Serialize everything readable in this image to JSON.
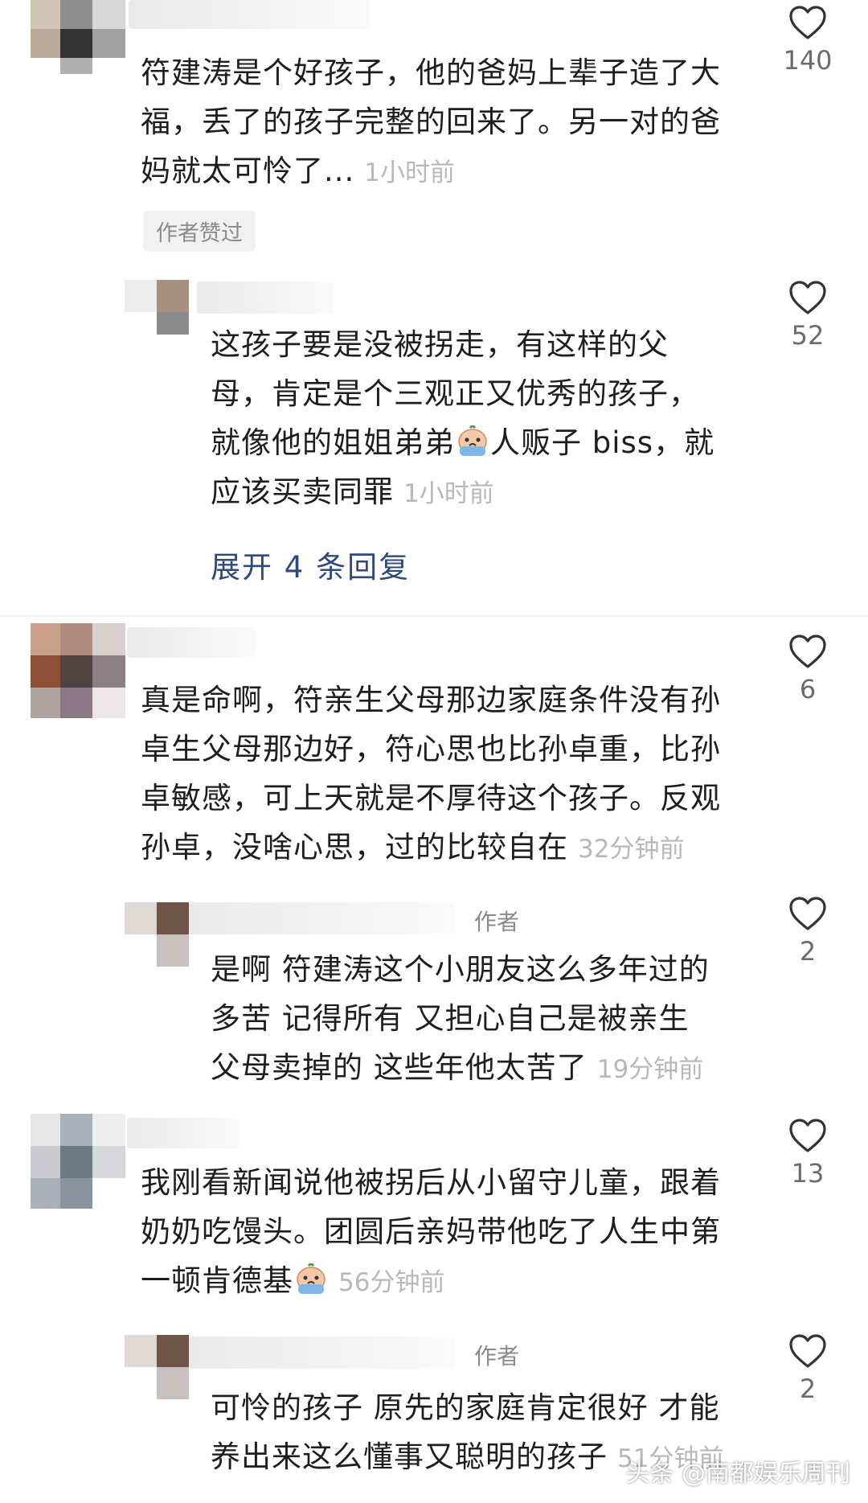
{
  "comments": [
    {
      "text": "符建涛是个好孩子，他的爸妈上辈子造了大福，丢了的孩子完整的回来了。另一对的爸妈就太可怜了...",
      "lines": [
        "符建涛是个好孩子，他的爸妈上辈子造了大",
        "福，丢了的孩子完整的回来了。另一对的爸",
        "妈就太可怜了..."
      ],
      "time": "1小时前",
      "likes": "140",
      "badge": "作者赞过"
    },
    {
      "lines": [
        "这孩子要是没被拐走，有这样的父",
        "母，肯定是个三观正又优秀的孩子，",
        "就像他的姐姐弟弟",
        "人贩子 biss，就",
        "应该买卖同罪"
      ],
      "time": "1小时前",
      "likes": "52",
      "expand": "展开 4 条回复"
    },
    {
      "lines": [
        "真是命啊，符亲生父母那边家庭条件没有孙",
        "卓生父母那边好，符心思也比孙卓重，比孙",
        "卓敏感，可上天就是不厚待这个孩子。反观",
        "孙卓，没啥心思，过的比较自在"
      ],
      "time": "32分钟前",
      "likes": "6"
    },
    {
      "author_tag": "作者",
      "lines": [
        "是啊  符建涛这个小朋友这么多年过的",
        "多苦  记得所有  又担心自己是被亲生",
        "父母卖掉的   这些年他太苦了"
      ],
      "time": "19分钟前",
      "likes": "2"
    },
    {
      "lines": [
        "我刚看新闻说他被拐后从小留守儿童，跟着",
        "奶奶吃馒头。团圆后亲妈带他吃了人生中第",
        "一顿肯德基"
      ],
      "time": "56分钟前",
      "likes": "13"
    },
    {
      "author_tag": "作者",
      "lines": [
        "可怜的孩子 原先的家庭肯定很好  才能",
        "养出来这么懂事又聪明的孩子"
      ],
      "time": "51分钟前",
      "likes": "2"
    }
  ],
  "watermark": "头条 @南都娱乐周刊",
  "colors": {
    "link": "#2f4a7a",
    "time": "#b8b8b8",
    "count": "#6b6b6b"
  },
  "icons": {
    "like": "heart-outline-icon",
    "emoji": "crying-face-emoji"
  }
}
